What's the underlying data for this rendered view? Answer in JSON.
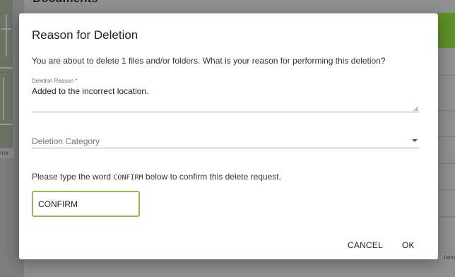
{
  "background": {
    "page_title": "Documents",
    "map_caption": "rror",
    "footer_text": "Item"
  },
  "dialog": {
    "title": "Reason for Deletion",
    "description": "You are about to delete 1 files and/or folders. What is your reason for performing this deletion?",
    "reason_field": {
      "label": "Deletion Reason *",
      "value": "Added to the incorrect location."
    },
    "category_field": {
      "placeholder": "Deletion Category"
    },
    "confirm_instruction": {
      "before": "Please type the word ",
      "keyword": "CONFIRM",
      "after": " below to confirm this delete request."
    },
    "confirm_input": {
      "value": "CONFIRM"
    },
    "buttons": {
      "cancel": "CANCEL",
      "ok": "OK"
    }
  },
  "colors": {
    "accent_green": "#8bc34a",
    "overlay": "#8c8c8c"
  }
}
